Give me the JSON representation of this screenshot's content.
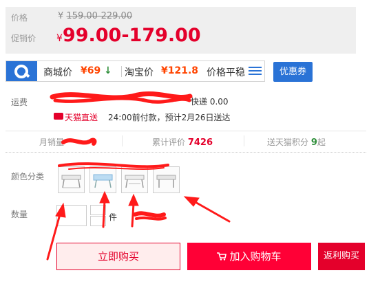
{
  "price": {
    "label": "价格",
    "original_currency": "¥",
    "original_range": "159.00-229.00",
    "promo_label": "促销价",
    "promo_currency": "¥",
    "promo_range": "99.00-179.00"
  },
  "compare": {
    "mall_label": "商城价",
    "mall_value": "¥69",
    "mall_trend": "↓",
    "taobao_label": "淘宝价",
    "taobao_value": "¥121.8",
    "trend_label": "价格平稳",
    "coupon_button": "优惠券"
  },
  "shipping": {
    "label": "运费",
    "value": "快递 0.00",
    "tmall_direct": "天猫直送",
    "delivery": "24:00前付款，预计2月26日送达"
  },
  "stats": {
    "monthly_sales_label": "月销量",
    "reviews_label": "累计评价",
    "reviews_value": "7426",
    "points_label": "送天猫积分",
    "points_value": "9",
    "points_suffix": "起"
  },
  "options": {
    "color_label": "颜色分类",
    "quantity_label": "数量",
    "quantity_unit": "件"
  },
  "actions": {
    "buy_now": "立即购买",
    "add_to_cart": "加入购物车",
    "rebate_buy": "返利购买"
  },
  "colors": {
    "accent_red": "#e4002b",
    "cart_red": "#ff0036",
    "brand_blue": "#2a73d6"
  }
}
